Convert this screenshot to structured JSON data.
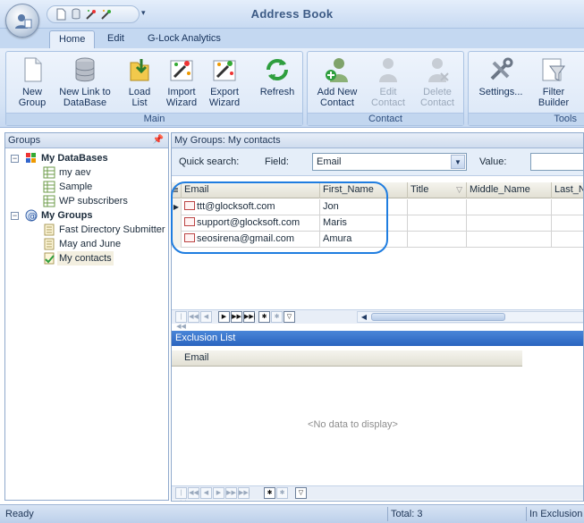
{
  "app": {
    "title": "Address Book"
  },
  "tabs": [
    {
      "label": "Home",
      "active": true
    },
    {
      "label": "Edit",
      "active": false
    },
    {
      "label": "G-Lock Analytics",
      "active": false
    }
  ],
  "ribbon": {
    "groups": [
      {
        "label": "Main",
        "buttons": [
          {
            "line1": "New",
            "line2": "Group",
            "icon": "new-group-icon",
            "enabled": true
          },
          {
            "line1": "New Link to",
            "line2": "DataBase",
            "icon": "database-icon",
            "enabled": true
          },
          {
            "line1": "Load",
            "line2": "List",
            "icon": "load-list-icon",
            "enabled": true
          },
          {
            "line1": "Import",
            "line2": "Wizard",
            "icon": "import-wizard-icon",
            "enabled": true
          },
          {
            "line1": "Export",
            "line2": "Wizard",
            "icon": "export-wizard-icon",
            "enabled": true
          },
          {
            "line1": "Refresh",
            "line2": "",
            "icon": "refresh-icon",
            "enabled": true
          }
        ]
      },
      {
        "label": "Contact",
        "buttons": [
          {
            "line1": "Add New",
            "line2": "Contact",
            "icon": "add-contact-icon",
            "enabled": true
          },
          {
            "line1": "Edit",
            "line2": "Contact",
            "icon": "edit-contact-icon",
            "enabled": false
          },
          {
            "line1": "Delete",
            "line2": "Contact",
            "icon": "delete-contact-icon",
            "enabled": false
          }
        ]
      },
      {
        "label": "Tools",
        "buttons": [
          {
            "line1": "Settings...",
            "line2": "",
            "icon": "settings-icon",
            "enabled": true
          },
          {
            "line1": "Filter",
            "line2": "Builder",
            "icon": "filter-builder-icon",
            "enabled": true
          }
        ]
      }
    ]
  },
  "groups_panel": {
    "title": "Groups",
    "databases_label": "My DataBases",
    "databases": [
      "my aev",
      "Sample",
      "WP subscribers"
    ],
    "groups_label": "My Groups",
    "groups": [
      "Fast Directory Submitter",
      "May and June",
      "My contacts"
    ],
    "selected": "My contacts"
  },
  "contacts_pane": {
    "title": "My Groups: My contacts",
    "quick_search_label": "Quick search:",
    "field_label": "Field:",
    "field_value": "Email",
    "value_label": "Value:",
    "value": "",
    "columns": [
      "Email",
      "First_Name",
      "Title",
      "Middle_Name",
      "Last_N"
    ],
    "rows": [
      {
        "email": "ttt@glocksoft.com",
        "first_name": "Jon",
        "title": "",
        "middle_name": "",
        "last_name": ""
      },
      {
        "email": "support@glocksoft.com",
        "first_name": "Maris",
        "title": "",
        "middle_name": "",
        "last_name": ""
      },
      {
        "email": "seosirena@gmail.com",
        "first_name": "Amura",
        "title": "",
        "middle_name": "",
        "last_name": ""
      }
    ]
  },
  "exclusion": {
    "title": "Exclusion List",
    "column": "Email",
    "empty_text": "<No data to display>"
  },
  "status": {
    "left": "Ready",
    "total": "Total: 3",
    "right": "In Exclusion"
  },
  "colors": {
    "ribbon_bg": "#d5e3f5",
    "exclusion_header": "#2a64bf",
    "highlight_oval": "#1f7de0"
  }
}
